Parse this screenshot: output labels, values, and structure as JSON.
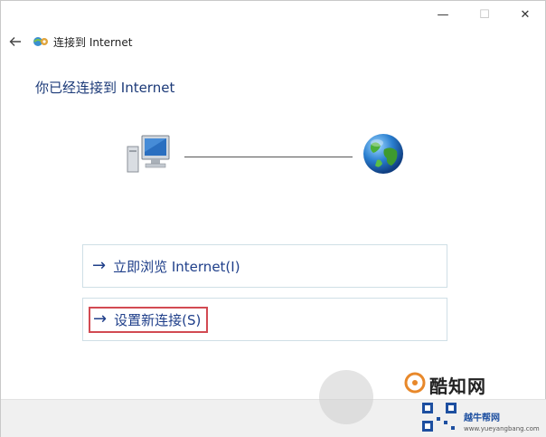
{
  "window": {
    "title": "连接到 Internet",
    "controls": {
      "minimize": "—",
      "maximize": "☐",
      "close": "✕"
    }
  },
  "main": {
    "heading": "你已经连接到 Internet",
    "commands": [
      {
        "arrow": "→",
        "label": "立即浏览 Internet(I)"
      },
      {
        "arrow": "→",
        "label": "设置新连接(S)"
      }
    ]
  },
  "watermark": {
    "brand": "酷知网",
    "site_name": "越牛帮网",
    "site_url": "www.yueyangbang.com"
  },
  "colors": {
    "accent": "#1f3f8a",
    "highlight": "#d24a52",
    "heading": "#1c3a78"
  }
}
